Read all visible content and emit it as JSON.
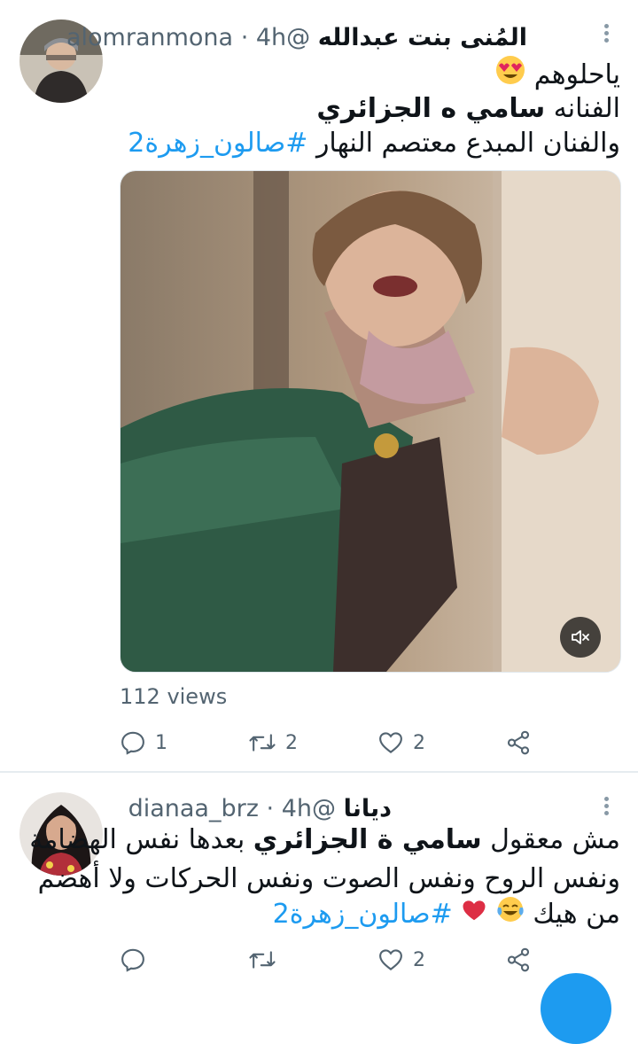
{
  "tweets": [
    {
      "display_name": "المُنى بنت عبدالله",
      "handle": "@alomranmona",
      "separator": "·",
      "time": "4h",
      "lines": [
        "ياحلوهم",
        "الفنانه سامي ه الجزائري",
        "والفنان المبدع معتصم النهار #صالون_زهرة2"
      ],
      "line2_plain": "الفنانه",
      "line2_bold": "سامي ه الجزائري",
      "line3_plain": "والفنان المبدع معتصم النهار",
      "line3_hashtag": "#صالون_زهرة2",
      "views": "112 views",
      "actions": {
        "reply": "1",
        "retweet": "2",
        "like": "2"
      }
    },
    {
      "display_name": "ديانا",
      "handle": "@dianaa_brz",
      "separator": "·",
      "time": "4h",
      "line1_plain": "مش معقول",
      "line1_bold": "سامي ة الجزائري",
      "line1_rest": "بعدها نفس الهضامة",
      "line2": "ونفس الروح ونفس الصوت ونفس الحركات ولا أهضم",
      "line3_plain": "من هيك",
      "line3_hashtag": "#صالون_زهرة2",
      "actions": {
        "reply": "",
        "retweet": "",
        "like": "2"
      }
    }
  ],
  "colors": {
    "accent": "#1d9bf0",
    "muted": "#536471",
    "divider": "#e6ecf0",
    "heart": "#e0245e"
  },
  "icons": [
    "more-icon",
    "reply-icon",
    "retweet-icon",
    "like-icon",
    "share-icon",
    "mute-icon",
    "heart-eyes-emoji",
    "red-heart-emoji",
    "tears-of-joy-emoji"
  ]
}
